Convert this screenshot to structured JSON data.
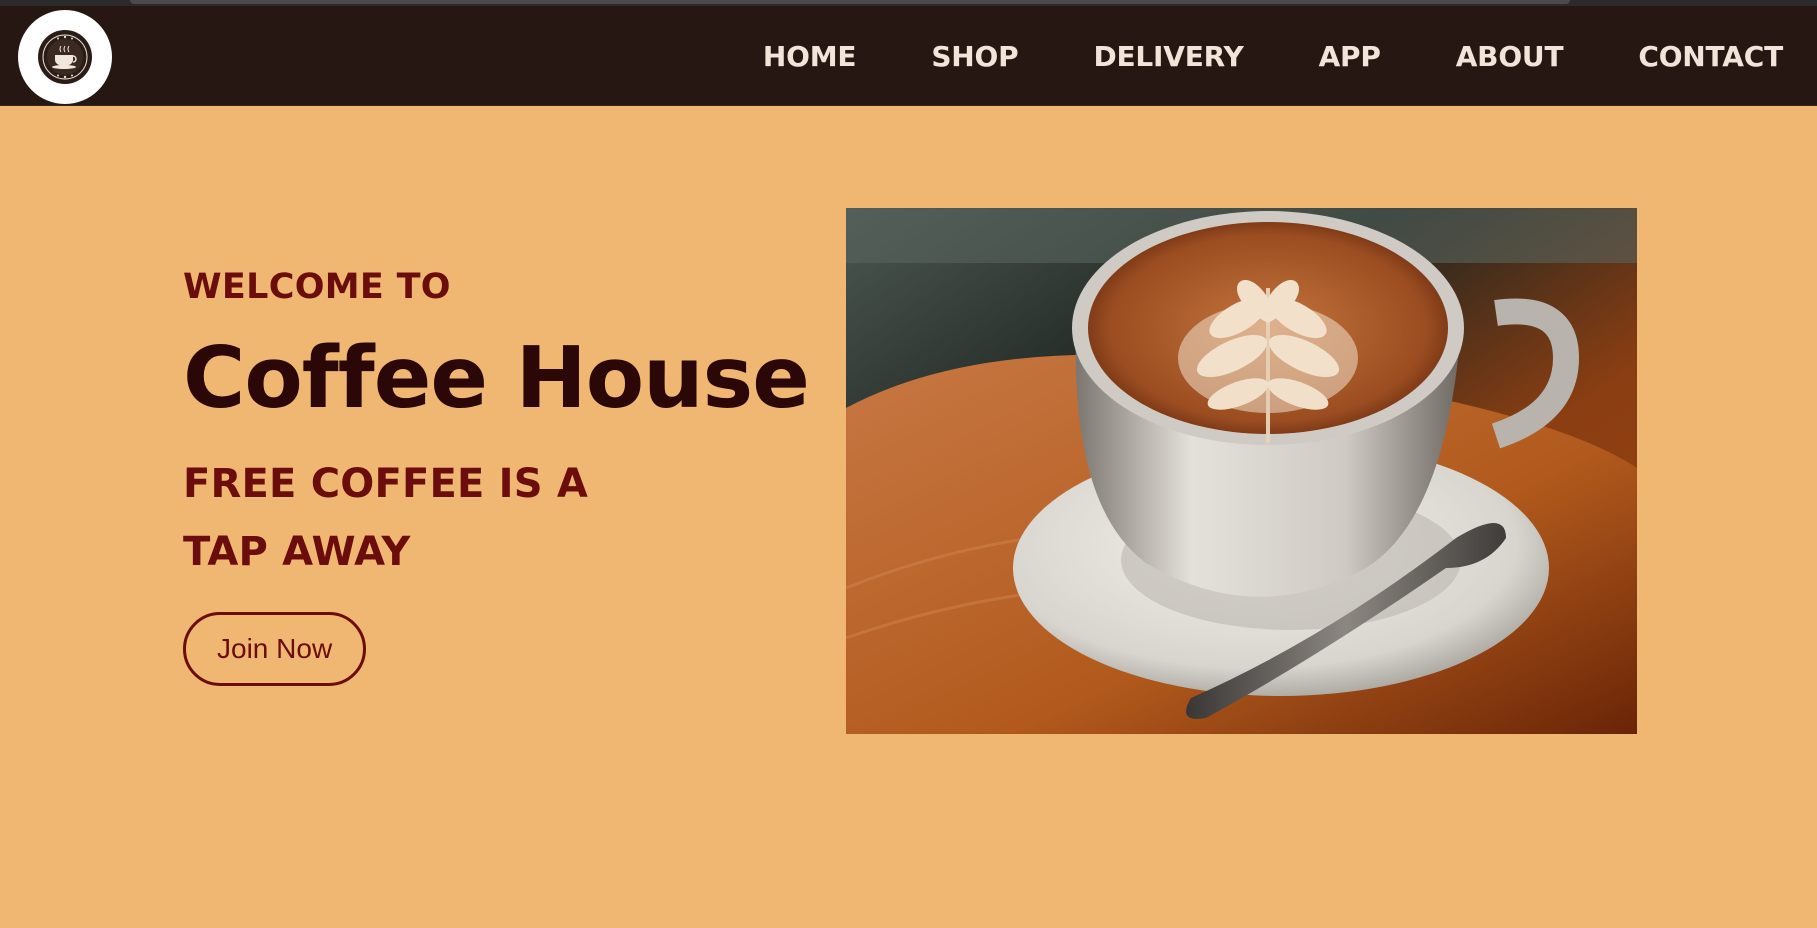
{
  "nav": {
    "logo_icon": "coffee-cup-logo-icon",
    "links": [
      "HOME",
      "SHOP",
      "DELIVERY",
      "APP",
      "ABOUT",
      "CONTACT"
    ]
  },
  "hero": {
    "welcome": "WELCOME TO",
    "title": "Coffee House",
    "tagline_line1": "FREE COFFEE IS A",
    "tagline_line2": "TAP AWAY",
    "cta_label": "Join Now",
    "image_subject": "latte-art-coffee-cup-image"
  },
  "colors": {
    "page_background": "#f0b772",
    "navbar_background": "#261713",
    "nav_text": "#f2e4d9",
    "accent_maroon": "#6b0d0c",
    "title_dark": "#2b0707"
  }
}
